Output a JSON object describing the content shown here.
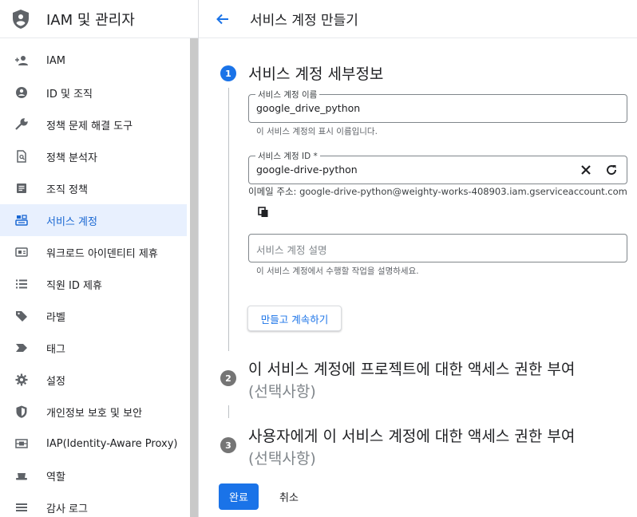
{
  "app": {
    "title": "IAM 및 관리자"
  },
  "sidebar": {
    "items": [
      {
        "label": "IAM",
        "icon": "person-add-icon"
      },
      {
        "label": "ID 및 조직",
        "icon": "account-circle-icon"
      },
      {
        "label": "정책 문제 해결 도구",
        "icon": "wrench-icon"
      },
      {
        "label": "정책 분석자",
        "icon": "document-search-icon"
      },
      {
        "label": "조직 정책",
        "icon": "list-document-icon"
      },
      {
        "label": "서비스 계정",
        "icon": "service-account-icon",
        "active": true
      },
      {
        "label": "워크로드 아이덴티티 제휴",
        "icon": "id-card-icon"
      },
      {
        "label": "직원 ID 제휴",
        "icon": "list-icon"
      },
      {
        "label": "라벨",
        "icon": "tag-icon"
      },
      {
        "label": "태그",
        "icon": "chevron-tag-icon"
      },
      {
        "label": "설정",
        "icon": "gear-icon"
      },
      {
        "label": "개인정보 보호 및 보안",
        "icon": "shield-icon"
      },
      {
        "label": "IAP(Identity-Aware Proxy)",
        "icon": "proxy-icon"
      },
      {
        "label": "역할",
        "icon": "hat-icon"
      },
      {
        "label": "감사 로그",
        "icon": "lines-icon"
      }
    ]
  },
  "header": {
    "title": "서비스 계정 만들기"
  },
  "steps": [
    {
      "number": "1",
      "title": "서비스 계정 세부정보"
    },
    {
      "number": "2",
      "title": "이 서비스 계정에 프로젝트에 대한 액세스 권한 부여",
      "optional": "(선택사항)"
    },
    {
      "number": "3",
      "title": "사용자에게 이 서비스 계정에 대한 액세스 권한 부여",
      "optional": "(선택사항)"
    }
  ],
  "form": {
    "name_label": "서비스 계정 이름",
    "name_value": "google_drive_python",
    "name_hint": "이 서비스 계정의 표시 이름입니다.",
    "id_label": "서비스 계정 ID *",
    "id_value": "google-drive-python",
    "email_text": "이메일 주소: google-drive-python@weighty-works-408903.iam.gserviceaccount.com",
    "desc_placeholder": "서비스 계정 설명",
    "desc_hint": "이 서비스 계정에서 수행할 작업을 설명하세요.",
    "continue_label": "만들고 계속하기"
  },
  "footer": {
    "done_label": "완료",
    "cancel_label": "취소"
  },
  "colors": {
    "accent": "#1a73e8",
    "active_bg": "#e8f0fe",
    "muted": "#757575"
  }
}
